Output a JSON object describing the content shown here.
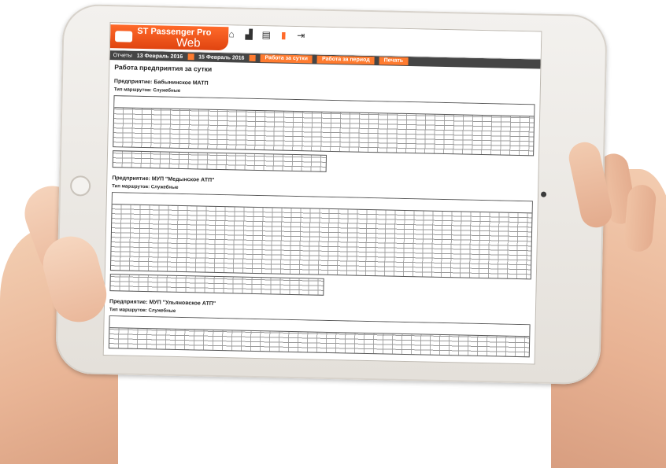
{
  "app": {
    "title": "ST Passenger Pro",
    "subtitle": "Web"
  },
  "nav": [
    {
      "icon": "home-icon",
      "glyph": "⌂"
    },
    {
      "icon": "bus-icon",
      "glyph": "▟"
    },
    {
      "icon": "list-icon",
      "glyph": "▤"
    },
    {
      "icon": "chart-icon",
      "glyph": "▮"
    },
    {
      "icon": "exit-icon",
      "glyph": "⇥"
    }
  ],
  "toolbar": {
    "reports_label": "Отчеты",
    "date_from": "13 Февраль 2016",
    "date_to": "15 Февраль 2016",
    "btn_day": "Работа за сутки",
    "btn_period": "Работа за период",
    "btn_print": "Печать"
  },
  "report": {
    "title": "Работа предприятия за сутки",
    "enterprises": [
      {
        "name": "Предприятие: Бабынинское МАТП",
        "type": "Тип маршрутов: Служебные"
      },
      {
        "name": "Предприятие: МУП \"Медынское АТП\"",
        "type": "Тип маршрутов: Служебные"
      },
      {
        "name": "Предприятие: МУП \"Ульяновское АТП\"",
        "type": "Тип маршрутов: Служебные"
      }
    ]
  }
}
